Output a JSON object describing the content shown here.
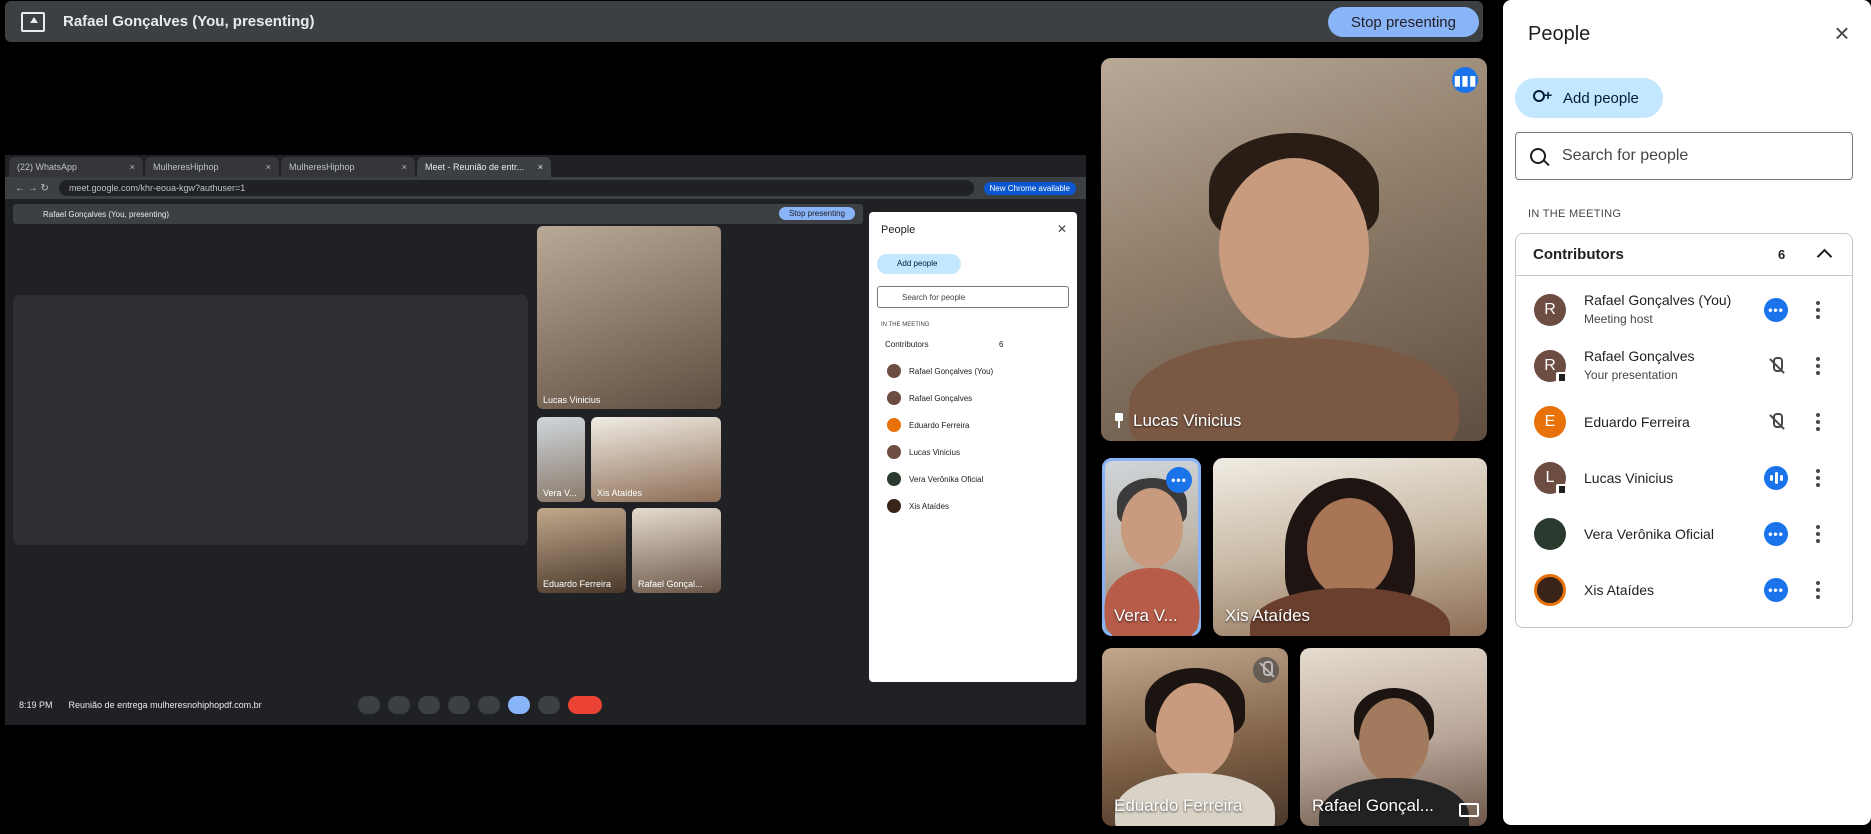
{
  "presenting": {
    "title": "Rafael Gonçalves (You, presenting)",
    "stop_label": "Stop presenting"
  },
  "shared_screen": {
    "tabs": [
      "(22) WhatsApp",
      "MulheresHiphop",
      "MulheresHiphop",
      "Meet - Reunião de entr..."
    ],
    "url": "meet.google.com/khr-eoua-kgw?authuser=1",
    "chrome_badge": "New Chrome available",
    "inner_title": "Rafael Gonçalves (You, presenting)",
    "inner_stop": "Stop presenting",
    "inner_people_title": "People",
    "inner_add_people": "Add people",
    "inner_search": "Search for people",
    "inner_section": "IN THE MEETING",
    "inner_contributors": "Contributors",
    "inner_count": "6",
    "inner_names": [
      "Rafael Gonçalves (You)",
      "Rafael Gonçalves",
      "Eduardo Ferreira",
      "Lucas Vinicius",
      "Vera Verônika Oficial",
      "Xis Ataídes"
    ],
    "inner_tiles": [
      "Lucas Vinicius",
      "Vera V...",
      "Xis Ataídes",
      "Eduardo Ferreira",
      "Rafael Gonçal..."
    ],
    "time": "8:19 PM",
    "meeting": "Reunião de entrega mulheresnohiphopdf.com.br"
  },
  "tiles": {
    "lucas": "Lucas Vinicius",
    "vera": "Vera V...",
    "xis": "Xis Ataídes",
    "eduardo": "Eduardo Ferreira",
    "rafael": "Rafael Gonçal..."
  },
  "panel": {
    "title": "People",
    "add_people": "Add people",
    "search_placeholder": "Search for people",
    "section_label": "IN THE MEETING",
    "contributors_label": "Contributors",
    "contributors_count": "6",
    "people": [
      {
        "initial": "R",
        "name": "Rafael Gonçalves (You)",
        "sub": "Meeting host",
        "color": "#6d4c41",
        "status": "more"
      },
      {
        "initial": "R",
        "name": "Rafael Gonçalves",
        "sub": "Your presentation",
        "color": "#6d4c41",
        "status": "presenting-muted"
      },
      {
        "initial": "E",
        "name": "Eduardo Ferreira",
        "sub": "",
        "color": "#e8710a",
        "status": "muted"
      },
      {
        "initial": "L",
        "name": "Lucas Vinicius",
        "sub": "",
        "color": "#6d4c41",
        "status": "talking"
      },
      {
        "initial": "",
        "name": "Vera Verônika Oficial",
        "sub": "",
        "color": "#2b3a2e",
        "status": "more"
      },
      {
        "initial": "",
        "name": "Xis Ataídes",
        "sub": "",
        "color": "#3a2418",
        "status": "more"
      }
    ]
  },
  "colors": {
    "accent": "#8ab4f8",
    "status_blue": "#1a73e8",
    "add_people_bg": "#c2e7ff"
  }
}
